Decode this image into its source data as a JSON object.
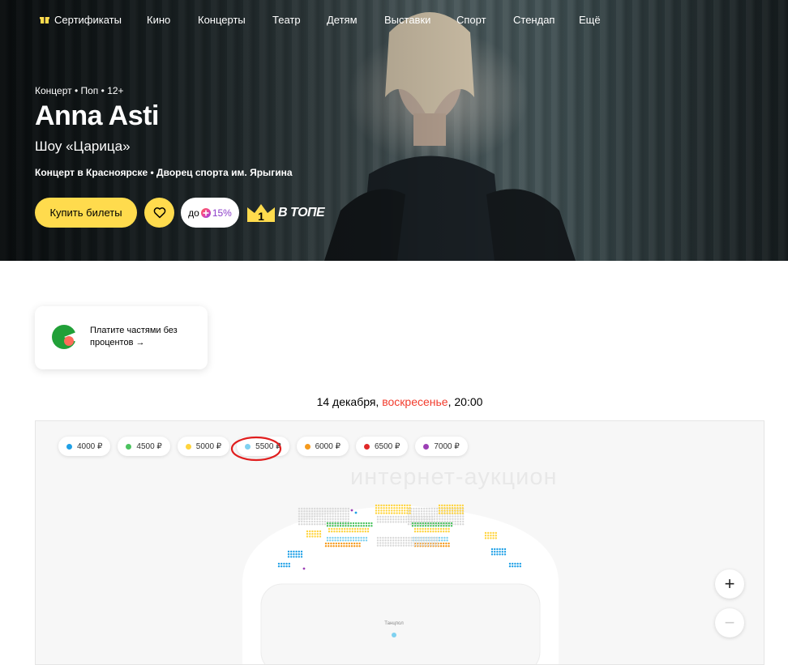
{
  "nav": {
    "items": [
      "Сертификаты",
      "Кино",
      "Концерты",
      "Театр",
      "Детям",
      "Выставки",
      "Спорт",
      "Стендап",
      "Ещё"
    ]
  },
  "event": {
    "tags": [
      "Концерт",
      "Поп",
      "12+"
    ],
    "title": "Anna Asti",
    "subtitle": "Шоу «Царица»",
    "city": "Концерт в Красноярске",
    "venue": "Дворец спорта им. Ярыгина"
  },
  "actions": {
    "buy_label": "Купить билеты",
    "plus_prefix": "до",
    "plus_percent": "15%",
    "top_number": "1",
    "top_label": "В ТОПЕ"
  },
  "split": {
    "text": "Платите частями без процентов →"
  },
  "date": {
    "day": "14 декабря, ",
    "weekday": "воскресенье",
    "sep": ", ",
    "time": "20:00"
  },
  "legend": [
    {
      "label": "4000 ₽",
      "color": "#1fa0e6"
    },
    {
      "label": "4500 ₽",
      "color": "#4cc35f"
    },
    {
      "label": "5000 ₽",
      "color": "#ffd43d"
    },
    {
      "label": "5500 ₽",
      "color": "#7fd1f0"
    },
    {
      "label": "6000 ₽",
      "color": "#f59a1d"
    },
    {
      "label": "6500 ₽",
      "color": "#e02828"
    },
    {
      "label": "7000 ₽",
      "color": "#9c3fb5"
    }
  ],
  "hall": {
    "watermark": "интернет-аукцион",
    "stage_label": "Танцпол",
    "zoom_in": "+",
    "zoom_out": "−"
  },
  "colors": {
    "accent": "#ffdb4d",
    "weekday": "#f23c2d",
    "highlight": "#e01e1e"
  }
}
